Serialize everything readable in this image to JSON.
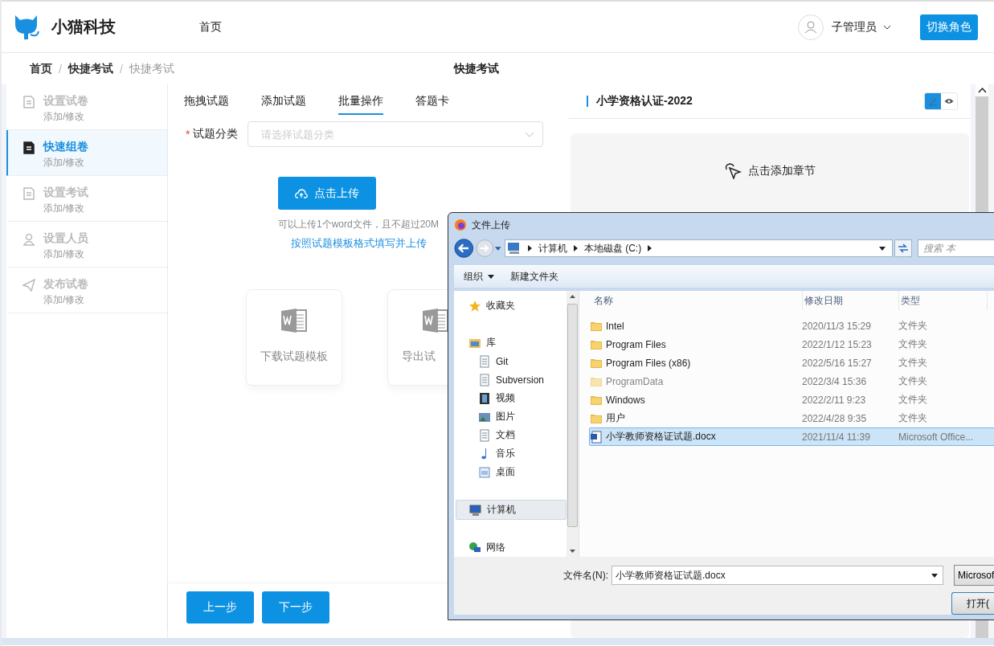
{
  "header": {
    "brand": "小猫科技",
    "nav": [
      {
        "label": "首页",
        "selected": false
      }
    ],
    "user": "子管理员",
    "switch_button": "切换角色"
  },
  "breadcrumb": {
    "items": [
      "首页",
      "快捷考试",
      "快捷考试"
    ],
    "separator": "/",
    "page_title": "快捷考试"
  },
  "sidebar": {
    "items": [
      {
        "title": "设置试卷",
        "subtitle": "添加/修改",
        "selected": false
      },
      {
        "title": "快速组卷",
        "subtitle": "添加/修改",
        "selected": true
      },
      {
        "title": "设置考试",
        "subtitle": "添加/修改",
        "selected": false
      },
      {
        "title": "设置人员",
        "subtitle": "添加/修改",
        "selected": false
      },
      {
        "title": "发布试卷",
        "subtitle": "添加/修改",
        "selected": false
      }
    ]
  },
  "tabs": [
    {
      "label": "拖拽试题",
      "selected": false
    },
    {
      "label": "添加试题",
      "selected": false
    },
    {
      "label": "批量操作",
      "selected": true
    },
    {
      "label": "答题卡",
      "selected": false
    }
  ],
  "form": {
    "required_mark": "*",
    "label": "试题分类",
    "placeholder": "请选择试题分类"
  },
  "upload": {
    "button": "点击上传",
    "hint": "可以上传1个word文件，且不超过20M",
    "link": "按照试题模板格式填写并上传"
  },
  "cards": [
    {
      "label": "下载试题模板"
    },
    {
      "label": "导出试"
    }
  ],
  "footer_buttons": [
    "上一步",
    "下一步"
  ],
  "paper": {
    "title": "小学资格认证-2022",
    "modes": [
      {
        "kind": "edit",
        "selected": true
      },
      {
        "kind": "view",
        "selected": false
      }
    ],
    "add_chapter": "点击添加章节"
  },
  "dialog": {
    "title": "文件上传",
    "path": [
      "计算机",
      "本地磁盘 (C:)"
    ],
    "search_placeholder": "搜索 本",
    "toolbar": [
      {
        "label": "组织",
        "menu": true
      },
      {
        "label": "新建文件夹",
        "menu": false
      }
    ],
    "nav": [
      {
        "label": "收藏夹",
        "selected": false
      },
      {
        "label": "库",
        "selected": false,
        "children": [
          {
            "label": "Git",
            "selected": false
          },
          {
            "label": "Subversion",
            "selected": false
          },
          {
            "label": "视频",
            "selected": false
          },
          {
            "label": "图片",
            "selected": false
          },
          {
            "label": "文档",
            "selected": false
          },
          {
            "label": "音乐",
            "selected": false
          },
          {
            "label": "桌面",
            "selected": false
          }
        ]
      },
      {
        "label": "计算机",
        "selected": true
      },
      {
        "label": "网络",
        "selected": false
      }
    ],
    "columns": [
      "名称",
      "修改日期",
      "类型"
    ],
    "rows": [
      {
        "name": "Intel",
        "date": "2020/11/3 15:29",
        "type": "文件夹",
        "kind": "folder",
        "hidden": false,
        "selected": false
      },
      {
        "name": "Program Files",
        "date": "2022/1/12 15:23",
        "type": "文件夹",
        "kind": "folder",
        "hidden": false,
        "selected": false
      },
      {
        "name": "Program Files (x86)",
        "date": "2022/5/16 15:27",
        "type": "文件夹",
        "kind": "folder",
        "hidden": false,
        "selected": false
      },
      {
        "name": "ProgramData",
        "date": "2022/3/4 15:36",
        "type": "文件夹",
        "kind": "folder",
        "hidden": true,
        "selected": false
      },
      {
        "name": "Windows",
        "date": "2022/2/11 9:23",
        "type": "文件夹",
        "kind": "folder",
        "hidden": false,
        "selected": false
      },
      {
        "name": "用户",
        "date": "2022/4/28 9:35",
        "type": "文件夹",
        "kind": "folder",
        "hidden": false,
        "selected": false
      },
      {
        "name": "小学教师资格证试题.docx",
        "date": "2021/11/4 11:39",
        "type": "Microsoft Office...",
        "kind": "document",
        "hidden": false,
        "selected": true
      }
    ],
    "filename_label": "文件名(N):",
    "filename": "小学教师资格证试题.docx",
    "filetype": "Microsof",
    "open_button": "打开("
  }
}
